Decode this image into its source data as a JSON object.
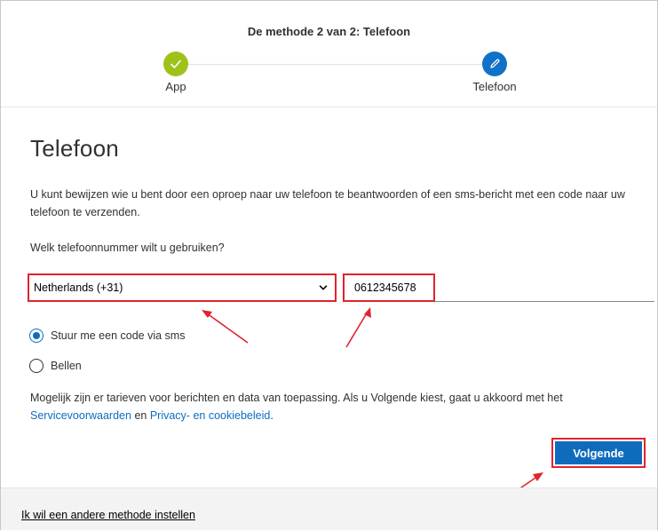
{
  "header": {
    "step_title": "De methode 2 van 2: Telefoon",
    "steps": [
      {
        "label": "App",
        "status": "done",
        "icon": "checkmark-icon"
      },
      {
        "label": "Telefoon",
        "status": "active",
        "icon": "pencil-icon"
      }
    ]
  },
  "main": {
    "title": "Telefoon",
    "description": "U kunt bewijzen wie u bent door een oproep naar uw telefoon te beantwoorden of een sms-bericht met een code naar uw telefoon te verzenden.",
    "question": "Welk telefoonnummer wilt u gebruiken?",
    "country_select": {
      "value": "Netherlands (+31)"
    },
    "phone_input": {
      "value": "0612345678"
    },
    "options": [
      {
        "label": "Stuur me een code via sms",
        "checked": true
      },
      {
        "label": "Bellen",
        "checked": false
      }
    ],
    "terms": {
      "text": "Mogelijk zijn er tarieven voor berichten en data van toepassing. Als u Volgende kiest, gaat u akkoord met het",
      "link_service": "Servicevoorwaarden",
      "conjunction": "en",
      "link_privacy": "Privacy- en cookiebeleid",
      "end": "."
    },
    "next_button": "Volgende"
  },
  "footer": {
    "other_method_link": "Ik wil een andere methode instellen"
  },
  "colors": {
    "accent_blue": "#0f6cbd",
    "done_green": "#9fc21a",
    "highlight_red": "#e0242e"
  }
}
